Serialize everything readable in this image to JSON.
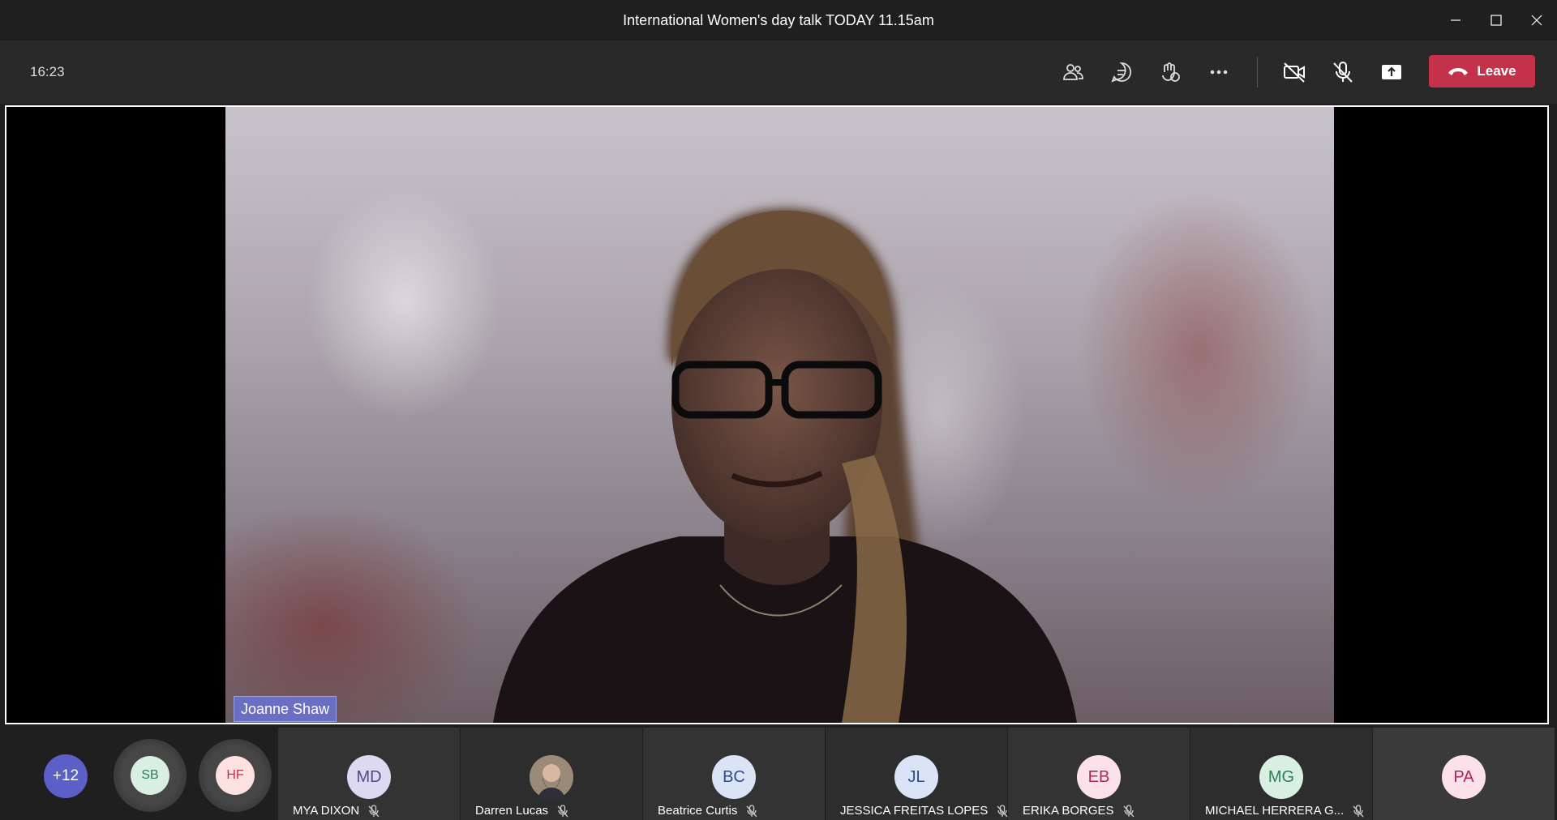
{
  "window": {
    "title": "International Women's day talk TODAY 11.15am"
  },
  "toolbar": {
    "timer": "16:23",
    "leave_label": "Leave",
    "icons": [
      "people-icon",
      "chat-icon",
      "reactions-icon",
      "more-options-icon",
      "camera-off-icon",
      "mic-off-icon",
      "share-screen-icon",
      "phone-hangup-icon"
    ]
  },
  "stage": {
    "speaker_name": "Joanne Shaw"
  },
  "strip": {
    "overflow_count": "+12",
    "small_avatars": [
      {
        "initials": "SB",
        "bg": "#d9efe2",
        "fg": "#2f7d55"
      },
      {
        "initials": "HF",
        "bg": "#fde1e1",
        "fg": "#c4314b"
      }
    ],
    "participants": [
      {
        "initials": "MD",
        "name": "MYA DIXON",
        "bg": "#dcd9f0",
        "fg": "#4f4a8a"
      },
      {
        "initials": "",
        "name": "Darren Lucas",
        "bg": "#8a7a6a",
        "fg": "#fff"
      },
      {
        "initials": "BC",
        "name": "Beatrice Curtis",
        "bg": "#dbe4f7",
        "fg": "#2b4c8c"
      },
      {
        "initials": "JL",
        "name": "JESSICA FREITAS LOPES",
        "bg": "#dbe4f7",
        "fg": "#2b4c8c"
      },
      {
        "initials": "EB",
        "name": "ERIKA BORGES",
        "bg": "#fde1ea",
        "fg": "#b0284f"
      },
      {
        "initials": "MG",
        "name": "MICHAEL HERRERA G...",
        "bg": "#d9efe2",
        "fg": "#2f7d55"
      },
      {
        "initials": "PA",
        "name": "",
        "bg": "#fde1ea",
        "fg": "#b0284f"
      }
    ]
  },
  "colors": {
    "leave": "#c4314b",
    "overflow_badge": "#5b5fc7",
    "name_tag": "#6a6fc4"
  }
}
